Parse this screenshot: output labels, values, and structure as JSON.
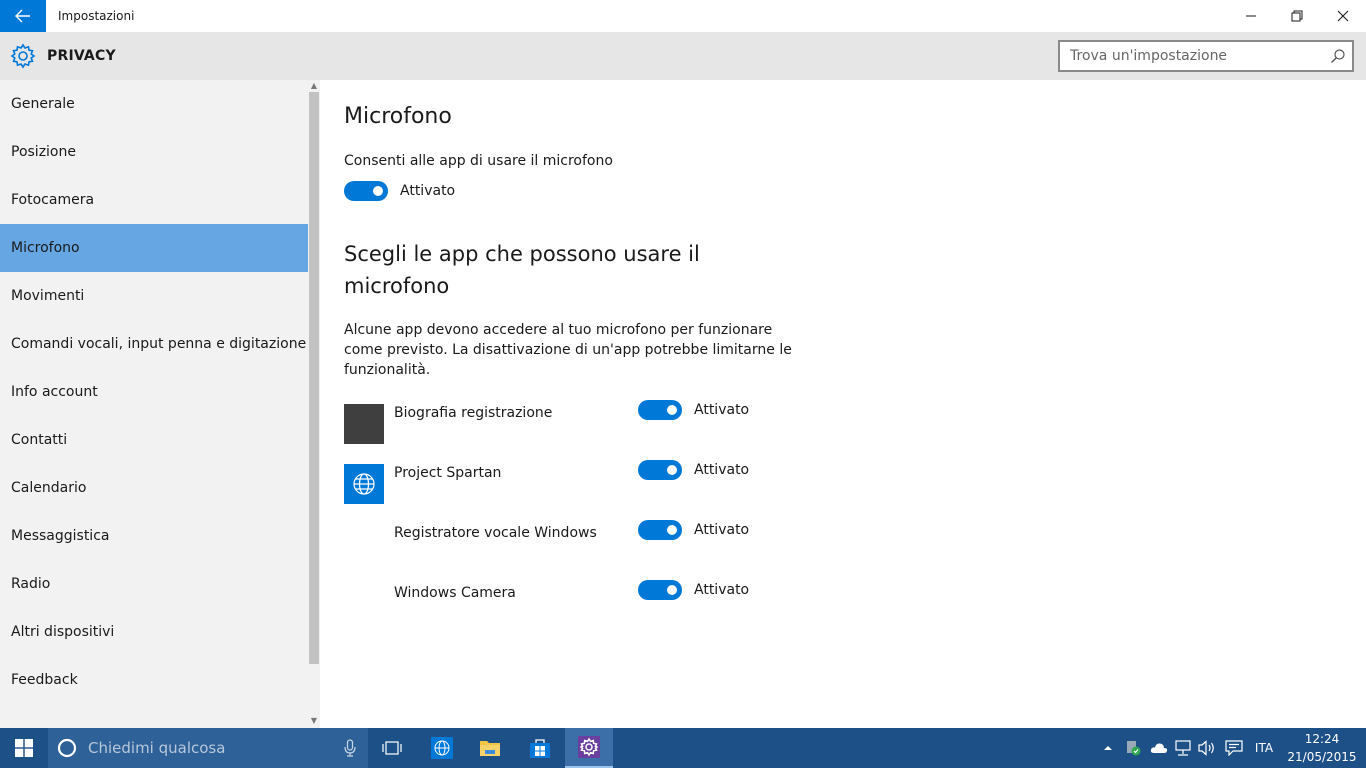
{
  "window": {
    "title": "Impostazioni",
    "back_icon": "arrow-left-icon",
    "controls": [
      "minimize-icon",
      "restore-icon",
      "close-icon"
    ]
  },
  "header": {
    "icon": "gear-icon",
    "title": "PRIVACY",
    "search": {
      "placeholder": "Trova un'impostazione",
      "value": ""
    }
  },
  "sidebar": {
    "items": [
      {
        "label": "Generale",
        "active": false
      },
      {
        "label": "Posizione",
        "active": false
      },
      {
        "label": "Fotocamera",
        "active": false
      },
      {
        "label": "Microfono",
        "active": true
      },
      {
        "label": "Movimenti",
        "active": false
      },
      {
        "label": "Comandi vocali, input penna e digitazione",
        "active": false
      },
      {
        "label": "Info account",
        "active": false
      },
      {
        "label": "Contatti",
        "active": false
      },
      {
        "label": "Calendario",
        "active": false
      },
      {
        "label": "Messaggistica",
        "active": false
      },
      {
        "label": "Radio",
        "active": false
      },
      {
        "label": "Altri dispositivi",
        "active": false
      },
      {
        "label": "Feedback",
        "active": false
      }
    ]
  },
  "main": {
    "title": "Microfono",
    "master": {
      "label": "Consenti alle app di usare il microfono",
      "state": "Attivato",
      "on": true
    },
    "section_title": "Scegli le app che possono usare il microfono",
    "section_desc": "Alcune app devono accedere al tuo microfono per funzionare come previsto. La disattivazione di un'app potrebbe limitarne le funzionalità.",
    "apps": [
      {
        "name": "Biografia registrazione",
        "state": "Attivato",
        "on": true,
        "tile": "dark-square"
      },
      {
        "name": "Project Spartan",
        "state": "Attivato",
        "on": true,
        "tile": "globe-icon"
      },
      {
        "name": "Registratore vocale Windows",
        "state": "Attivato",
        "on": true,
        "tile": ""
      },
      {
        "name": "Windows Camera",
        "state": "Attivato",
        "on": true,
        "tile": ""
      }
    ]
  },
  "taskbar": {
    "search_placeholder": "Chiedimi qualcosa",
    "language": "ITA",
    "time": "12:24",
    "date": "21/05/2015"
  },
  "colors": {
    "accent": "#0078d7",
    "active_nav": "#66a6e3",
    "taskbar": "#1e5088",
    "header_band": "#e6e6e6",
    "sidebar": "#f2f2f2"
  }
}
